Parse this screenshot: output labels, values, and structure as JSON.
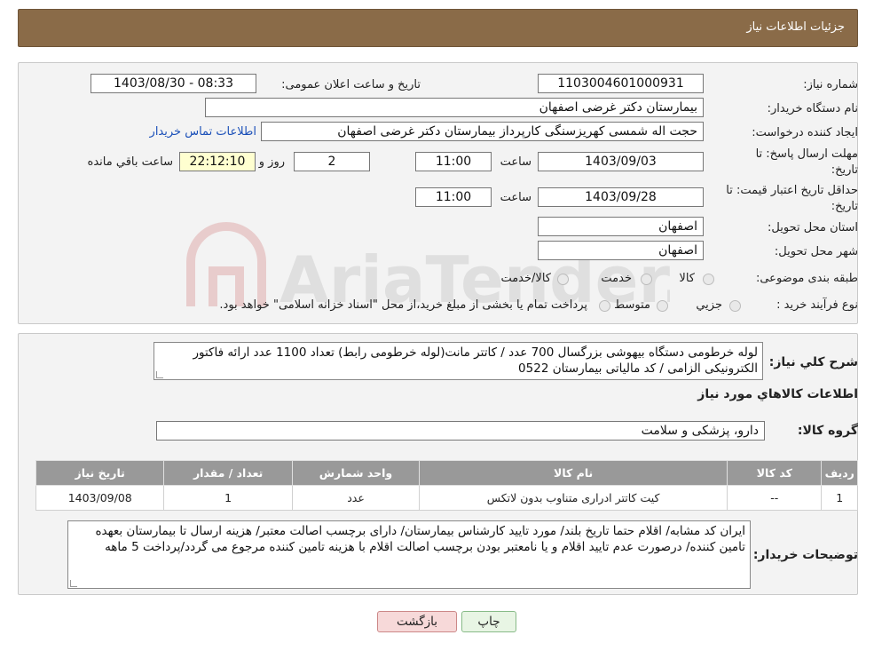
{
  "header": {
    "title": "جزئیات اطلاعات نیاز"
  },
  "form": {
    "need_number_label": "شماره نیاز:",
    "need_number": "1103004601000931",
    "announce_label": "تاریخ و ساعت اعلان عمومی:",
    "announce_value": "1403/08/30 - 08:33",
    "buyer_org_label": "نام دستگاه خريدار:",
    "buyer_org": "بیمارستان دکتر غرضی اصفهان",
    "creator_label": "ايجاد کننده درخواست:",
    "creator": "حجت اله شمسی کهریزسنگی کارپرداز بیمارستان دکتر غرضی اصفهان",
    "contact_link": "اطلاعات تماس خریدار",
    "deadline_label_1": "مهلت ارسال پاسخ: تا",
    "deadline_label_2": "تاريخ:",
    "deadline_date": "1403/09/03",
    "time_label": "ساعت",
    "deadline_time": "11:00",
    "days_value": "2",
    "days_label": "روز و",
    "remaining_time": "22:12:10",
    "remaining_label": "ساعت باقي مانده",
    "validity_label_1": "حداقل تاريخ اعتبار قيمت: تا",
    "validity_label_2": "تاريخ:",
    "validity_date": "1403/09/28",
    "validity_time": "11:00",
    "province_label": "استان محل تحويل:",
    "province": "اصفهان",
    "city_label": "شهر محل تحويل:",
    "city": "اصفهان",
    "category_label": "طبقه بندی موضوعی:",
    "category_options": [
      "کالا",
      "خدمت",
      "کالا/خدمت"
    ],
    "purchase_type_label": "نوع فرآیند خرید :",
    "purchase_options": [
      "جزيي",
      "متوسط"
    ],
    "purchase_note": "پرداخت تمام یا بخشی از مبلغ خرید،از محل \"اسناد خزانه اسلامی\" خواهد بود."
  },
  "description": {
    "label": "شرح كلي نياز:",
    "text": "لوله خرطومی دستگاه بیهوشی بزرگسال 700 عدد / کاتتر مانت(لوله خرطومی رابط) تعداد 1100 عدد ارائه فاکتور الکترونیکی الزامی / کد مالیاتی بیمارستان 0522"
  },
  "goods": {
    "section_title": "اطلاعات کالاهاي مورد نياز",
    "group_label": "گروه کالا:",
    "group_value": "دارو، پزشکی و سلامت",
    "columns": [
      "رديف",
      "کد کالا",
      "نام کالا",
      "واحد شمارش",
      "تعداد / مقدار",
      "تاريخ نياز"
    ],
    "rows": [
      [
        "1",
        "--",
        "کیت کاتتر ادراری متناوب بدون لاتکس",
        "عدد",
        "1",
        "1403/09/08"
      ]
    ]
  },
  "buyer_notes": {
    "label": "توضيحات خريدار:",
    "text": "ایران کد مشابه/ اقلام حتما تاریخ بلند/ مورد تایید کارشناس بیمارستان/ دارای برچسب اصالت معتبر/ هزینه ارسال تا بیمارستان بعهده تامین کننده/ درصورت عدم تایید اقلام و یا نامعتبر بودن برچسب اصالت اقلام با هزینه تامین کننده مرجوع می گردد/پرداخت 5 ماهه"
  },
  "buttons": {
    "print": "چاپ",
    "back": "بازگشت"
  },
  "watermark_text": "AriaTender.neT",
  "colors": {
    "header_bg": "#8a6b48",
    "table_header_bg": "#999999",
    "back_button_bg": "#f7d9d9",
    "time_bg": "#ffffd0"
  }
}
